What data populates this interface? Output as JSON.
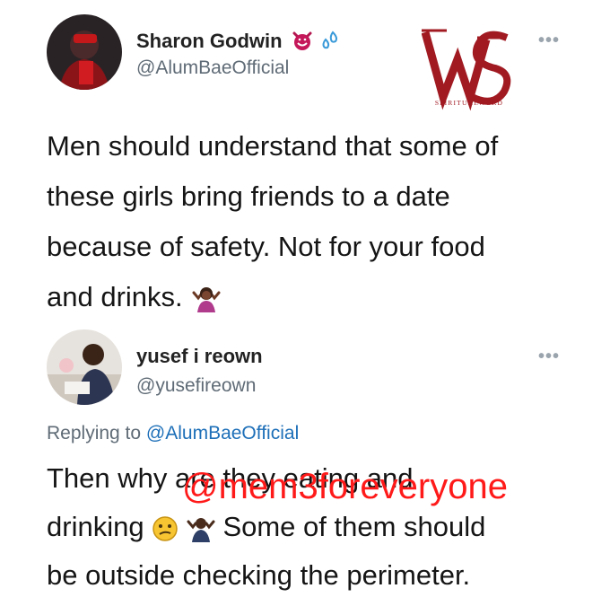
{
  "tweet1": {
    "name": "Sharon Godwin",
    "name_emojis": [
      "smiling-imp-emoji",
      "sweat-droplets-emoji"
    ],
    "handle": "@AlumBaeOfficial",
    "more": "•••",
    "lines": [
      "Men should understand that some of",
      "these girls bring friends to a date",
      "because of safety. Not for your food",
      "and drinks."
    ],
    "trailing_emoji": "shrugging-woman-emoji"
  },
  "logo": {
    "monogram": "SW",
    "caption": "SPIRITUALWORD",
    "color": "#a11a22"
  },
  "tweet2": {
    "name": "yusef i reown",
    "handle": "@yusefireown",
    "more": "•••",
    "replying_prefix": "Replying to ",
    "replying_to": "@AlumBaeOfficial",
    "line1": "Then why are they eating and",
    "line2_before": "drinking",
    "line2_after": "Some of them should",
    "line3": "be outside checking the perimeter.",
    "emojis": [
      "confused-face-emoji",
      "man-shrugging-emoji"
    ]
  },
  "watermark": {
    "text": "@mem3foreveryone",
    "color": "#ff1a1a"
  },
  "colors": {
    "handle": "#5f6b76",
    "mention": "#1d6fb8",
    "text": "#151515"
  }
}
